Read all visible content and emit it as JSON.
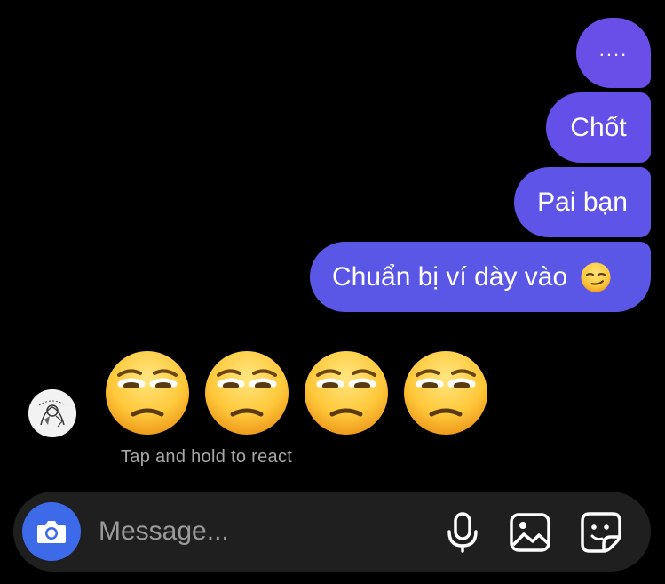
{
  "messages_sent": [
    {
      "text": "...."
    },
    {
      "text": "Chốt"
    },
    {
      "text": "Pai bạn"
    },
    {
      "text": "Chuẩn bị ví dày vào",
      "emoji": "smirking-face"
    }
  ],
  "received": {
    "emoji": [
      "unamused-face",
      "unamused-face",
      "unamused-face",
      "unamused-face"
    ],
    "hint": "Tap and hold to react"
  },
  "composer": {
    "placeholder": "Message...",
    "icons": [
      "camera-icon",
      "microphone-icon",
      "gallery-icon",
      "sticker-icon"
    ]
  },
  "colors": {
    "bubble_top": "#6a4ee8",
    "bubble_bottom": "#5a57e7",
    "camera_button": "#3d6ae8",
    "composer_bg": "#1f1f1f"
  }
}
